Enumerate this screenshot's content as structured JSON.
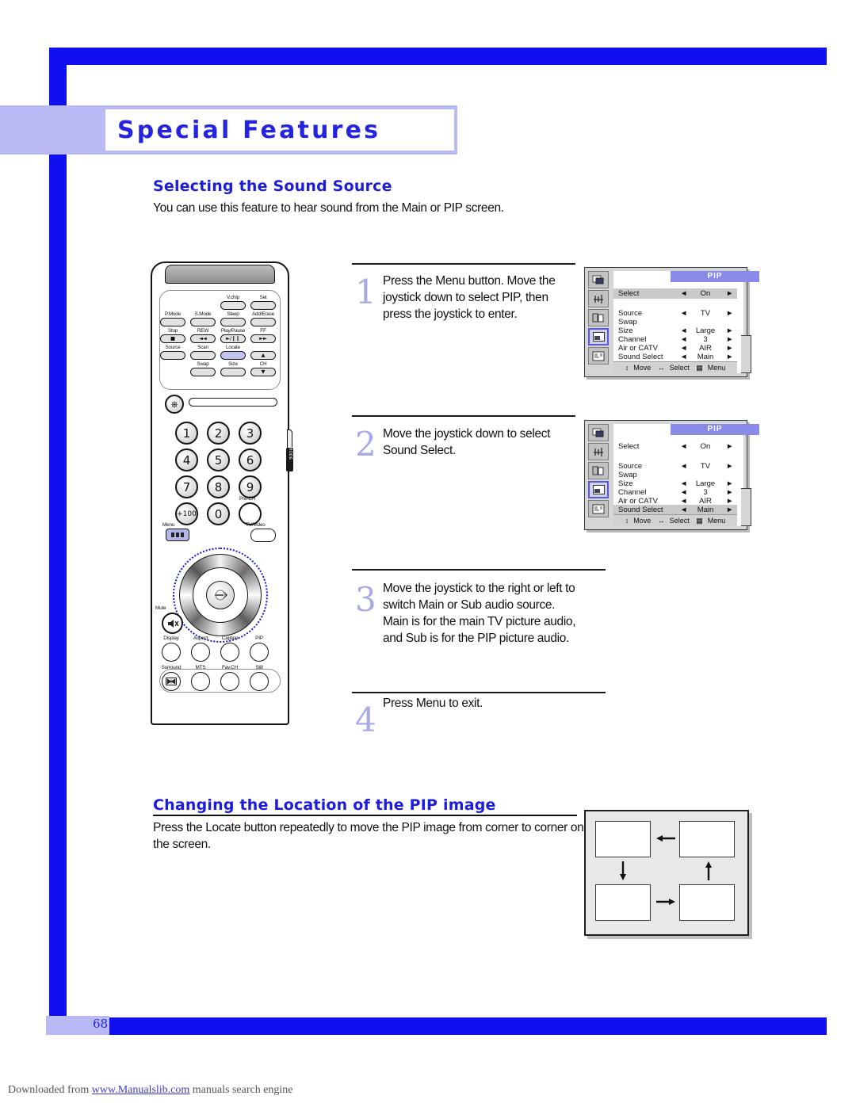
{
  "page": {
    "chapter_title": "Special Features",
    "page_number": "68",
    "footer_prefix": "Downloaded from ",
    "footer_link": "www.Manualslib.com",
    "footer_suffix": " manuals search engine"
  },
  "sections": [
    {
      "heading": "Selecting the Sound Source",
      "intro": "You can use this feature to hear sound from the Main or PIP screen."
    },
    {
      "heading": "Changing the Location of the PIP image",
      "intro": "Press the Locate button repeatedly to move the PIP image from corner to corner on the screen."
    }
  ],
  "steps": [
    {
      "number": "1",
      "text": "Press the Menu button. Move the joystick down to select PIP, then press the joystick to enter."
    },
    {
      "number": "2",
      "text": "Move the joystick down to select Sound Select."
    },
    {
      "number": "3",
      "text": "Move the joystick to the right or left to switch Main or Sub audio source. Main is for the main TV picture audio, and  Sub is for the PIP picture audio."
    },
    {
      "number": "4",
      "text": "Press Menu to exit."
    }
  ],
  "osd_menus": [
    {
      "title": "PIP",
      "highlight_row": "Select",
      "rows": [
        {
          "label": "Select",
          "left": "◄",
          "value": "On",
          "right": "►"
        },
        {
          "label": "Source",
          "left": "◄",
          "value": "TV",
          "right": "►"
        },
        {
          "label": "Swap",
          "left": "",
          "value": "",
          "right": ""
        },
        {
          "label": "Size",
          "left": "◄",
          "value": "Large",
          "right": "►"
        },
        {
          "label": "Channel",
          "left": "◄",
          "value": "3",
          "right": "►"
        },
        {
          "label": "Air or CATV",
          "left": "◄",
          "value": "AIR",
          "right": "►"
        },
        {
          "label": "Sound Select",
          "left": "◄",
          "value": "Main",
          "right": "►"
        }
      ],
      "footer": {
        "move": "Move",
        "select": "Select",
        "menu": "Menu"
      }
    },
    {
      "title": "PIP",
      "highlight_row": "Sound Select",
      "rows": [
        {
          "label": "Select",
          "left": "◄",
          "value": "On",
          "right": "►"
        },
        {
          "label": "Source",
          "left": "◄",
          "value": "TV",
          "right": "►"
        },
        {
          "label": "Swap",
          "left": "",
          "value": "",
          "right": ""
        },
        {
          "label": "Size",
          "left": "◄",
          "value": "Large",
          "right": "►"
        },
        {
          "label": "Channel",
          "left": "◄",
          "value": "3",
          "right": "►"
        },
        {
          "label": "Air or CATV",
          "left": "◄",
          "value": "AIR",
          "right": "►"
        },
        {
          "label": "Sound Select",
          "left": "◄",
          "value": "Main",
          "right": "►"
        }
      ],
      "footer": {
        "move": "Move",
        "select": "Select",
        "menu": "Menu"
      }
    }
  ],
  "pip_location_diagram": {
    "arrows": [
      "left",
      "down",
      "up",
      "right"
    ],
    "boxes": [
      "top-left",
      "top-right",
      "bottom-left",
      "bottom-right"
    ]
  },
  "remote": {
    "buttons_row1": [
      "V.chip",
      "Set"
    ],
    "buttons_row2": [
      "P.Mode",
      "S.Mode",
      "Sleep",
      "Add/Erase"
    ],
    "buttons_row3": [
      "Stop",
      "REW",
      "Play/Pause",
      "FF"
    ],
    "buttons_row3_glyphs": [
      "■",
      "◄◄",
      "►/❙❙",
      "►►"
    ],
    "buttons_row4": [
      "Source",
      "Scan",
      "Locate",
      ""
    ],
    "buttons_row5": [
      "Swap",
      "Size",
      "CH"
    ],
    "numbers": [
      "1",
      "2",
      "3",
      "4",
      "5",
      "6",
      "7",
      "8",
      "9",
      "+100",
      "0",
      ""
    ],
    "pre_ch": "Pre-CH",
    "menu": "Menu",
    "tv_video": "TV/Video",
    "mute": "Mute",
    "buttons_row6": [
      "Display",
      "Aspect",
      "Caption",
      "PIP"
    ],
    "buttons_row7": [
      "Surround",
      "MTS",
      "Fav.CH",
      "Still"
    ],
    "mode_tab": "MODE",
    "up_glyph": "▲",
    "down_glyph": "▼"
  },
  "colors": {
    "brand_blue": "#0f0fef",
    "heading_blue": "#1c1cdb",
    "lilac": "#b9b9f5",
    "osd_title_bg": "#8a8ae8"
  }
}
